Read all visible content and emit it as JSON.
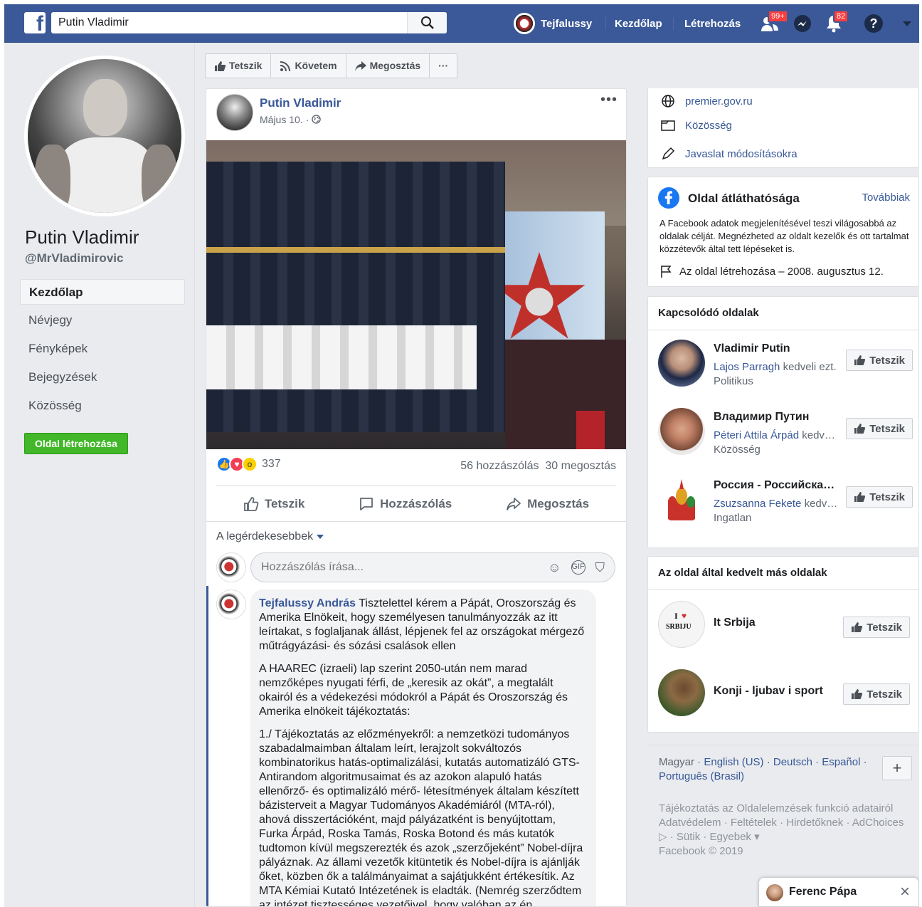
{
  "topbar": {
    "search_value": "Putin Vladimir",
    "user_name": "Tejfalussy",
    "home": "Kezdőlap",
    "create": "Létrehozás",
    "friend_badge": "99+",
    "notif_badge": "82"
  },
  "profile": {
    "name": "Putin Vladimir",
    "handle": "@MrVladimirovic",
    "nav": [
      "Kezdőlap",
      "Névjegy",
      "Fényképek",
      "Bejegyzések",
      "Közösség"
    ],
    "create_page": "Oldal létrehozása"
  },
  "actionbar": {
    "like": "Tetszik",
    "follow": "Követem",
    "share": "Megosztás",
    "more": "···"
  },
  "post": {
    "author": "Putin Vladimir",
    "date": "Május 10. ·",
    "reaction_count": "337",
    "comments": "56 hozzászólás",
    "shares": "30 megosztás",
    "like": "Tetszik",
    "comment": "Hozzászólás",
    "share": "Megosztás",
    "sort": "A legérdekesebbek",
    "comment_placeholder": "Hozzászólás írása...",
    "comment_author": "Tejfalussy András",
    "comment_p1": "Tisztelettel kérem a Pápát, Oroszország és Amerika Elnökeit, hogy személyesen tanulmányozzák az itt leírtakat, s foglaljanak állást, lépjenek fel az országokat mérgező műtrágyázási- és sózási csalások ellen",
    "comment_p2": "A HAAREC (izraeli) lap szerint 2050-után nem marad nemzőképes nyugati férfi, de „keresik az okát”, a megtalált okairól és a védekezési módokról a Pápát és Oroszország és Amerika elnökeit tájékoztatás:",
    "comment_p3": "1./ Tájékoztatás az előzményekről: a nemzetközi tudományos szabadalmaimban általam leírt, lerajzolt sokváltozós kombinatorikus hatás-optimalizálási, kutatás automatizáló GTS-Antirandom algoritmusaimat és az azokon alapuló hatás ellenőrző- és optimalizáló mérő- létesítmények általam készített bázisterveit a Magyar Tudományos Akadémiáról (MTA-ról), ahová disszertációként, majd pályázatként is benyújtottam, Furka Árpád, Roska Tamás, Roska Botond és más kutatók tudtomon kívül megszerezték és azok „szerzőjeként” Nobel-díjra pályáznak. Az állami vezetők kitüntetik és Nobel-díjra is ajánlják őket, közben ők a találmányaimat a sajátjukként értékesítik. Az MTA Kémiai Kutató Intézetének is eladták. (Nemrég szerződtem az intézet tisztességes vezetőivel, hogy valóban az én"
  },
  "about": {
    "website": "premier.gov.ru",
    "community": "Közösség",
    "suggest": "Javaslat módosításokra"
  },
  "transparency": {
    "title": "Oldal átláthatósága",
    "more": "Továbbiak",
    "desc": "A Facebook adatok megjelenítésével teszi világosabbá az oldalak célját. Megnézheted az oldalt kezelők és ott tartalmat közzétevők által tett lépéseket is.",
    "created": "Az oldal létrehozása – 2008. augusztus 12."
  },
  "related": {
    "title": "Kapcsolódó oldalak",
    "items": [
      {
        "name": "Vladimir Putin",
        "friend": "Lajos Parragh",
        "liked": " kedveli ezt.",
        "category": "Politikus",
        "like": "Tetszik"
      },
      {
        "name": "Владимир Путин",
        "friend": "Péteri Attila Árpád",
        "liked": " kedveli ezt.",
        "category": "Közösség",
        "like": "Tetszik"
      },
      {
        "name": "Россия - Российская Федерация",
        "friend": "Zsuzsanna Fekete",
        "liked": " kedveli ezt.",
        "category": "Ingatlan",
        "like": "Tetszik"
      }
    ]
  },
  "liked_pages": {
    "title": "Az oldal által kedvelt más oldalak",
    "items": [
      {
        "name": "It Srbija",
        "like": "Tetszik"
      },
      {
        "name": "Konji - ljubav i sport",
        "like": "Tetszik"
      }
    ]
  },
  "footer": {
    "lang_current": "Magyar · ",
    "langs": "English (US) · Deutsch · Español · Português (Brasil)",
    "links": "Tájékoztatás az Oldalelemzések funkció adatairól Adatvédelem · Feltételek · Hirdetőknek · AdChoices ▷ · Sütik · Egyebek ▾",
    "copyright": "Facebook © 2019"
  },
  "chat": {
    "name": "Ferenc Pápa"
  },
  "colors": {
    "brand": "#3b5998",
    "link": "#385898",
    "green": "#42b72a"
  }
}
